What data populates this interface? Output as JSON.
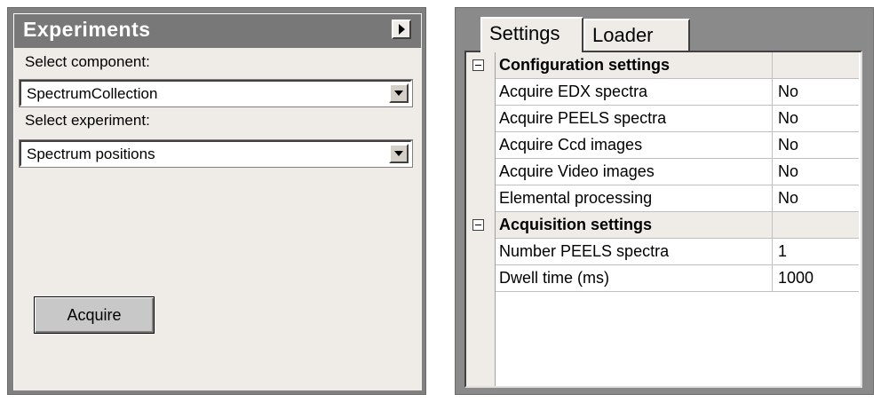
{
  "experiments": {
    "title": "Experiments",
    "select_component_label": "Select component:",
    "component_value": "SpectrumCollection",
    "select_experiment_label": "Select experiment:",
    "experiment_value": "Spectrum positions",
    "acquire_label": "Acquire"
  },
  "tabs": [
    {
      "label": "Settings",
      "active": true
    },
    {
      "label": "Loader",
      "active": false
    }
  ],
  "grid": {
    "categories": [
      {
        "name": "Configuration settings",
        "rows": [
          {
            "name": "Acquire EDX spectra",
            "value": "No"
          },
          {
            "name": "Acquire PEELS spectra",
            "value": "No"
          },
          {
            "name": "Acquire Ccd images",
            "value": "No"
          },
          {
            "name": "Acquire Video images",
            "value": "No"
          },
          {
            "name": "Elemental processing",
            "value": "No"
          }
        ]
      },
      {
        "name": "Acquisition settings",
        "rows": [
          {
            "name": "Number PEELS spectra",
            "value": "1"
          },
          {
            "name": "Dwell time (ms)",
            "value": "1000"
          }
        ]
      }
    ]
  }
}
